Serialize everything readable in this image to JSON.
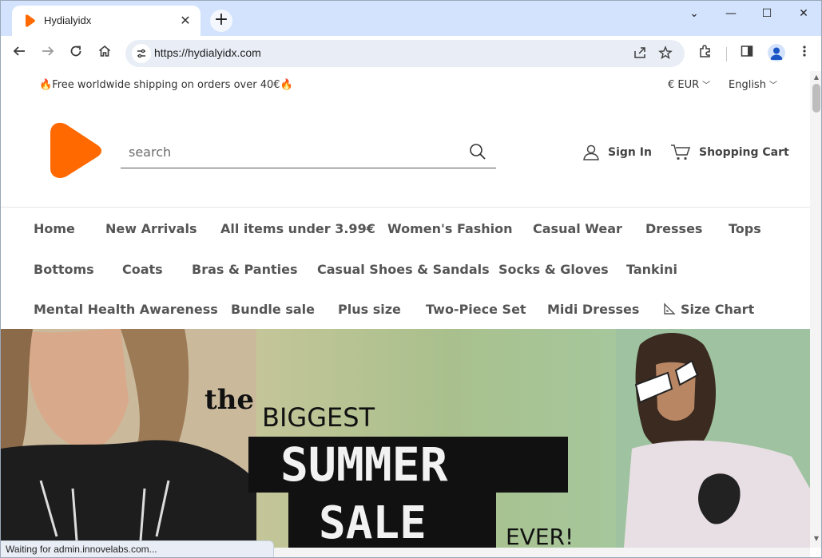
{
  "browser": {
    "tab_title": "Hydialyidx",
    "tab_close_glyph": "✕",
    "new_tab_glyph": "+",
    "url": "https://hydialyidx.com",
    "window_controls": {
      "minimize": "—",
      "maximize": "☐",
      "close": "✕",
      "tabsearch": "⌄"
    },
    "status_text": "Waiting for admin.innovelabs.com..."
  },
  "topbar": {
    "shipping_text": "Free worldwide shipping on orders over 40€",
    "currency": "€ EUR",
    "language": "English"
  },
  "header": {
    "search_placeholder": "search",
    "sign_in": "Sign In",
    "cart": "Shopping Cart"
  },
  "nav": {
    "items": [
      "Home",
      "New Arrivals",
      "All items under 3.99€",
      "Women's Fashion",
      "Casual Wear",
      "Dresses",
      "Tops",
      "Bottoms",
      "Coats",
      "Bras & Panties",
      "Casual Shoes & Sandals",
      "Socks & Gloves",
      "Tankini",
      "Mental Health Awareness",
      "Bundle sale",
      "Plus size",
      "Two-Piece Set",
      "Midi Dresses",
      "Size Chart"
    ]
  },
  "banner": {
    "line1": "the",
    "line2": "BIGGEST",
    "line3": "SUMMER",
    "line4": "SALE",
    "line5": "EVER!"
  },
  "colors": {
    "brand_orange": "#ff6900",
    "tab_strip": "#d3e3fd",
    "omnibox": "#e9eef6"
  },
  "icons": [
    "favicon-icon",
    "close-icon",
    "plus-icon",
    "back-icon",
    "forward-icon",
    "reload-icon",
    "home-icon",
    "site-info-icon",
    "share-icon",
    "star-icon",
    "extensions-icon",
    "sidepanel-icon",
    "profile-icon",
    "menu-icon",
    "flame-icon",
    "chevron-down-icon",
    "search-icon",
    "user-icon",
    "cart-icon",
    "ruler-icon"
  ]
}
